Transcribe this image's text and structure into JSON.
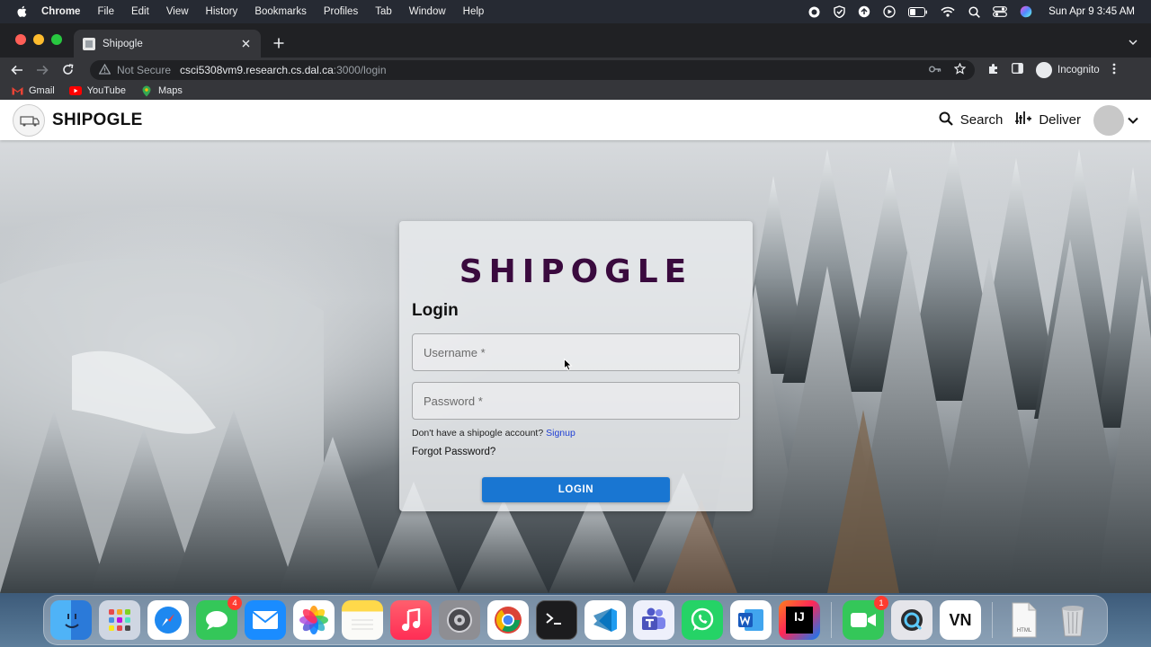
{
  "menubar": {
    "app": "Chrome",
    "items": [
      "File",
      "Edit",
      "View",
      "History",
      "Bookmarks",
      "Profiles",
      "Tab",
      "Window",
      "Help"
    ],
    "clock": "Sun Apr 9  3:45 AM"
  },
  "browser": {
    "tab_title": "Shipogle",
    "not_secure": "Not Secure",
    "url_host": "csci5308vm9.research.cs.dal.ca",
    "url_path": ":3000/login",
    "incognito": "Incognito",
    "bookmarks": [
      "Gmail",
      "YouTube",
      "Maps"
    ]
  },
  "appbar": {
    "brand": "SHIPOGLE",
    "search_label": "Search",
    "deliver_label": "Deliver"
  },
  "login": {
    "title": "SHIPOGLE",
    "heading": "Login",
    "username_placeholder": "Username *",
    "password_placeholder": "Password *",
    "no_account_text": "Don't have a shipogle account?",
    "signup_link": "Signup",
    "forgot_password": "Forgot Password?",
    "login_button": "LOGIN"
  },
  "dock": {
    "messages_badge": "4",
    "facetime_badge": "1",
    "vn_label": "VN",
    "intellij_label": "IJ",
    "html_label": "HTML"
  },
  "colors": {
    "brand_purple": "#3a0a3e",
    "button_blue": "#1976d2",
    "link_blue": "#1f3fd4"
  }
}
